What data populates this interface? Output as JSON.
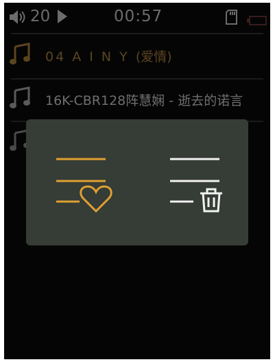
{
  "status_bar": {
    "volume_icon": "speaker-icon",
    "volume": "20",
    "play_icon": "play-icon",
    "time": "00:57",
    "storage_icon": "sd-card-icon",
    "battery_icon": "battery-icon"
  },
  "tracks": [
    {
      "icon": "music-note-icon",
      "title": "04 A I N Y",
      "title_suffix": "(爱情)",
      "state": "current",
      "color": "#c8962c"
    },
    {
      "icon": "music-note-icon",
      "title": "16K-CBR128阵慧娴 - 逝去的诺言",
      "state": "normal"
    },
    {
      "icon": "music-note-icon",
      "title": "",
      "state": "hidden"
    }
  ],
  "popup": {
    "options": [
      {
        "name": "add-to-favorites",
        "icon": "list-heart-icon",
        "selected": true,
        "color": "#e0a032"
      },
      {
        "name": "delete-from-list",
        "icon": "list-trash-icon",
        "selected": false,
        "color": "#f2f2f2"
      }
    ]
  }
}
